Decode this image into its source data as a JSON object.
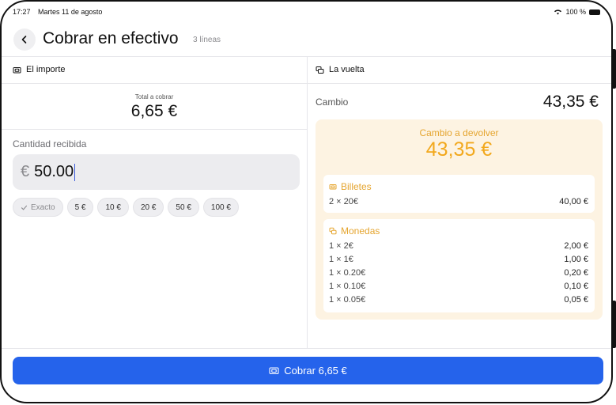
{
  "status_bar": {
    "time": "17:27",
    "date": "Martes 11 de agosto",
    "battery": "100 %"
  },
  "header": {
    "title": "Cobrar en efectivo",
    "subtitle": "3 líneas"
  },
  "left_panel": {
    "section_title": "El importe",
    "total_label": "Total a cobrar",
    "total_value": "6,65 €",
    "quantity_label": "Cantidad recibida",
    "currency_symbol": "€",
    "quantity_value": "50.00",
    "chips": [
      {
        "label": "Exacto",
        "icon": "check-icon"
      },
      {
        "label": "5 €"
      },
      {
        "label": "10 €"
      },
      {
        "label": "20 €"
      },
      {
        "label": "50 €"
      },
      {
        "label": "100 €"
      }
    ]
  },
  "right_panel": {
    "section_title": "La vuelta",
    "cambio_label": "Cambio",
    "cambio_value": "43,35 €",
    "change_title": "Cambio a devolver",
    "change_amount": "43,35 €",
    "billetes": {
      "title": "Billetes",
      "rows": [
        {
          "label": "2 × 20€",
          "value": "40,00 €"
        }
      ]
    },
    "monedas": {
      "title": "Monedas",
      "rows": [
        {
          "label": "1 × 2€",
          "value": "2,00 €"
        },
        {
          "label": "1 × 1€",
          "value": "1,00 €"
        },
        {
          "label": "1 × 0.20€",
          "value": "0,20 €"
        },
        {
          "label": "1 × 0.10€",
          "value": "0,10 €"
        },
        {
          "label": "1 × 0.05€",
          "value": "0,05 €"
        }
      ]
    }
  },
  "footer": {
    "pay_label": "Cobrar 6,65 €"
  },
  "colors": {
    "accent": "#2563eb",
    "change_text": "#f2a81d",
    "change_bg": "#fdf3e2"
  }
}
